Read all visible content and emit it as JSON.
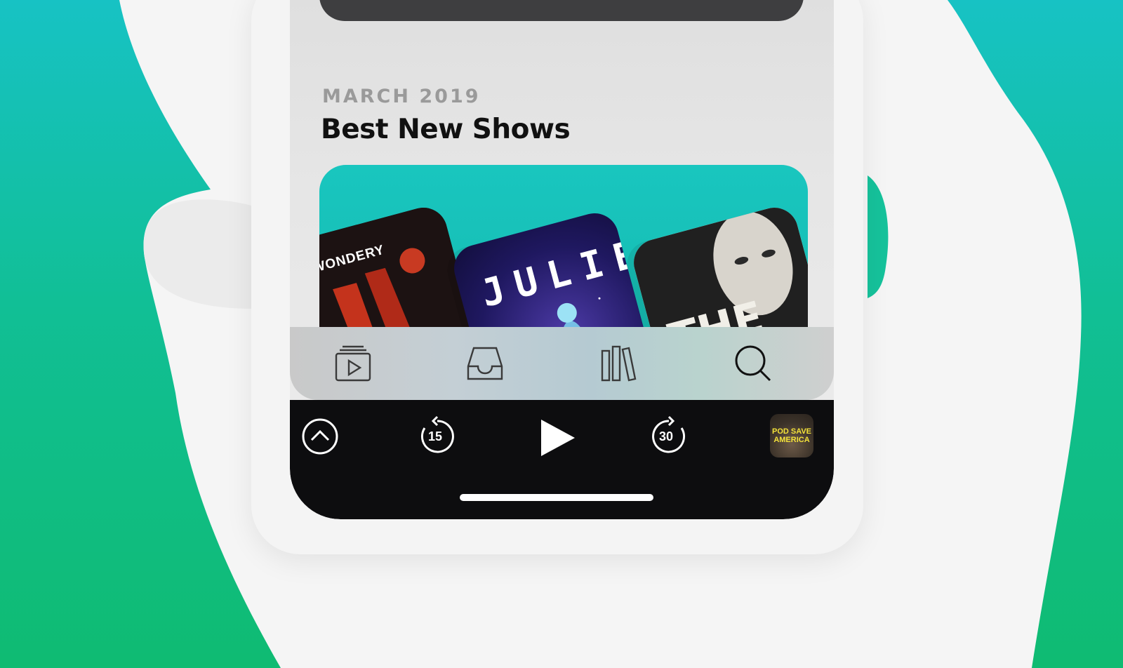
{
  "section": {
    "eyebrow": "MARCH 2019",
    "title": "Best New Shows"
  },
  "featured_art": [
    {
      "label": "WONDERY",
      "icon": "wondery-art"
    },
    {
      "label": "JULIE",
      "icon": "julie-art"
    },
    {
      "label": "THE DROP",
      "icon": "the-drop-art"
    }
  ],
  "tabs": [
    {
      "icon": "listen-now-icon"
    },
    {
      "icon": "inbox-icon"
    },
    {
      "icon": "library-icon"
    },
    {
      "icon": "search-icon"
    }
  ],
  "player": {
    "skip_back": "15",
    "skip_forward": "30",
    "now_playing_art": "POD SAVE AMERICA"
  },
  "colors": {
    "background_top": "#17c2c4",
    "background_bottom": "#0fbb72",
    "card": "#19c6bf",
    "player_bar": "#0d0d0f"
  }
}
